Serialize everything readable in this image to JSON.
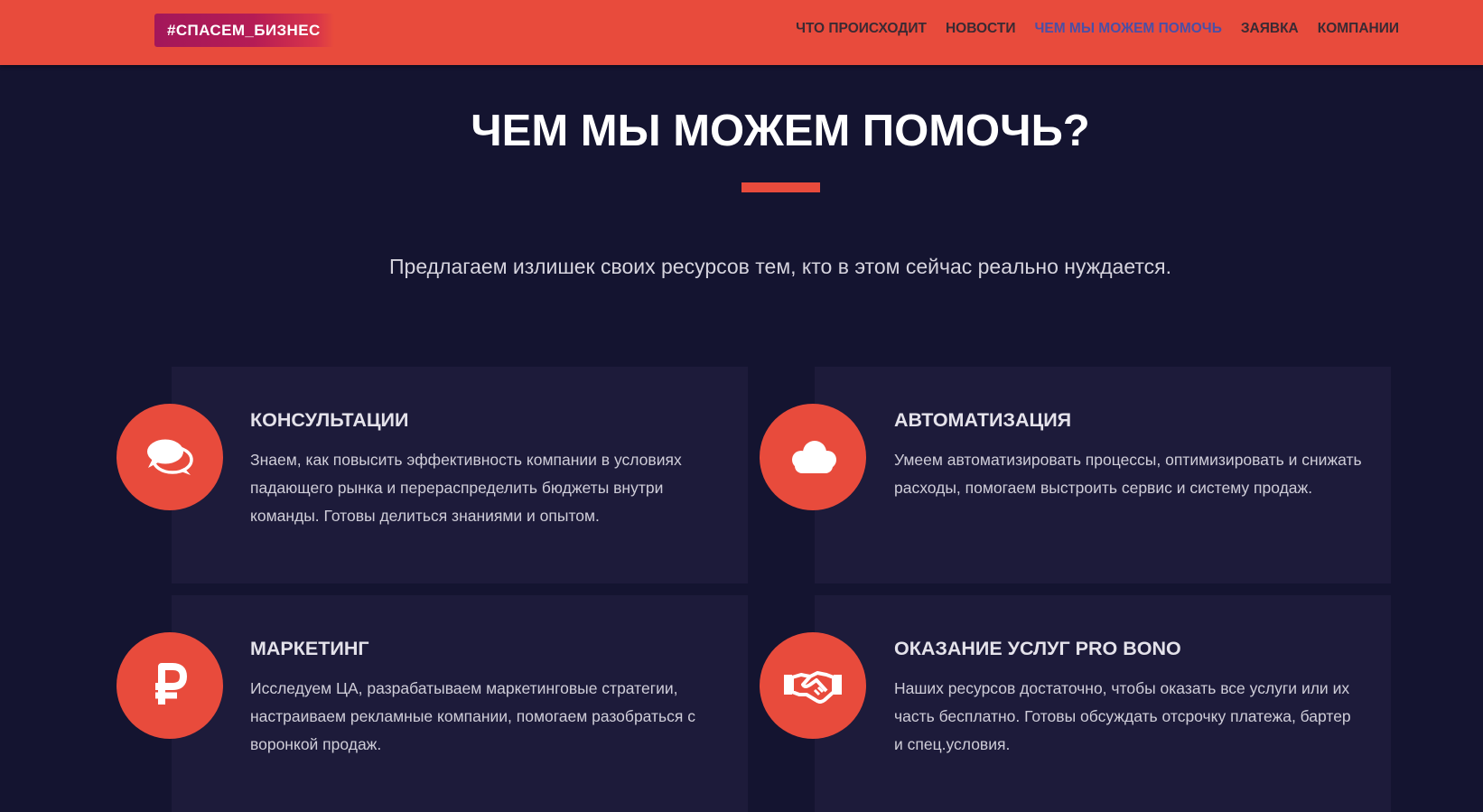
{
  "header": {
    "logo_text": "#СПАСЕМ_БИЗНЕС",
    "nav": [
      {
        "label": "ЧТО ПРОИСХОДИТ",
        "active": false
      },
      {
        "label": "НОВОСТИ",
        "active": false
      },
      {
        "label": "ЧЕМ МЫ МОЖЕМ ПОМОЧЬ",
        "active": true
      },
      {
        "label": "ЗАЯВКА",
        "active": false
      },
      {
        "label": "КОМПАНИИ",
        "active": false
      }
    ]
  },
  "main": {
    "title": "ЧЕМ МЫ МОЖЕМ ПОМОЧЬ?",
    "subtitle": "Предлагаем излишек своих ресурсов тем, кто в этом сейчас реально нуждается."
  },
  "services": [
    {
      "icon": "chat-bubbles-icon",
      "title": "КОНСУЛЬТАЦИИ",
      "text": "Знаем, как повысить эффективность компании в условиях падающего рынка и перераспределить бюджеты внутри команды. Готовы делиться знаниями и опытом."
    },
    {
      "icon": "cloud-icon",
      "title": "АВТОМАТИЗАЦИЯ",
      "text": "Умеем автоматизировать процессы, оптимизировать и снижать расходы, помогаем выстроить сервис и систему продаж."
    },
    {
      "icon": "ruble-icon",
      "title": "МАРКЕТИНГ",
      "text": "Исследуем ЦА, разрабатываем маркетинговые стратегии, настраиваем рекламные компании, помогаем разобраться с воронкой продаж."
    },
    {
      "icon": "handshake-icon",
      "title": "ОКАЗАНИЕ УСЛУГ PRO BONO",
      "text": "Наших ресурсов достаточно, чтобы оказать все услуги или их часть бесплатно. Готовы обсуждать отсрочку платежа,  бартер и спец.условия."
    }
  ],
  "colors": {
    "accent": "#e84b3c",
    "background": "#141430",
    "card": "#1d1b3a",
    "nav_active": "#4a4fa6"
  }
}
